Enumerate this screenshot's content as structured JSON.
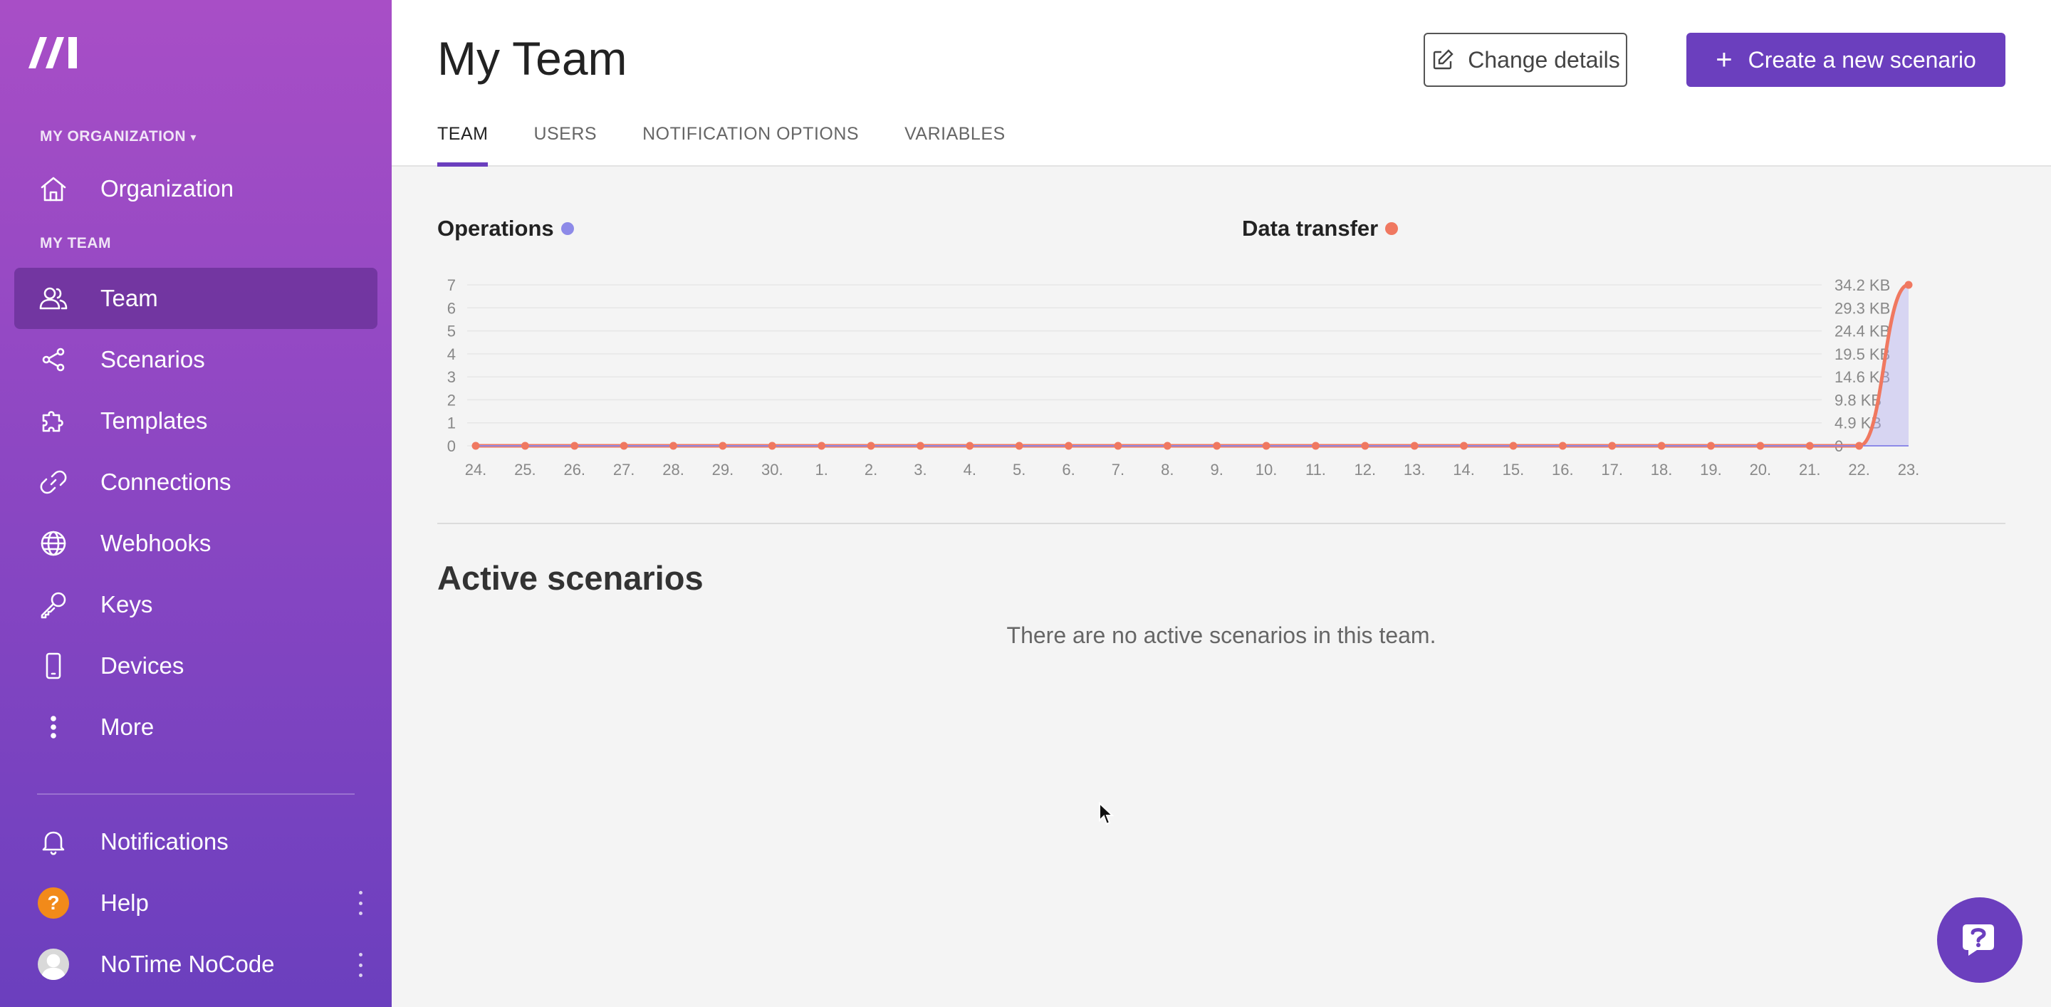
{
  "sidebar": {
    "org_label": "MY ORGANIZATION",
    "org_item": "Organization",
    "team_label": "MY TEAM",
    "items": [
      {
        "label": "Team",
        "icon": "team-icon"
      },
      {
        "label": "Scenarios",
        "icon": "share-icon"
      },
      {
        "label": "Templates",
        "icon": "puzzle-icon"
      },
      {
        "label": "Connections",
        "icon": "link-icon"
      },
      {
        "label": "Webhooks",
        "icon": "globe-icon"
      },
      {
        "label": "Keys",
        "icon": "key-icon"
      },
      {
        "label": "Devices",
        "icon": "phone-icon"
      },
      {
        "label": "More",
        "icon": "more-vertical-icon"
      }
    ],
    "notifications": "Notifications",
    "help": "Help",
    "help_badge": "?",
    "user": "NoTime NoCode"
  },
  "header": {
    "title": "My Team",
    "change_details": "Change details",
    "create_scenario": "Create a new scenario",
    "tabs": [
      "TEAM",
      "USERS",
      "NOTIFICATION OPTIONS",
      "VARIABLES"
    ],
    "active_tab": "TEAM"
  },
  "chart_data": {
    "type": "area",
    "series": [
      {
        "name": "Operations",
        "color": "#8d8ae8",
        "axis": "left",
        "values": [
          0,
          0,
          0,
          0,
          0,
          0,
          0,
          0,
          0,
          0,
          0,
          0,
          0,
          0,
          0,
          0,
          0,
          0,
          0,
          0,
          0,
          0,
          0,
          0,
          0,
          0,
          0,
          0,
          0,
          0,
          0
        ]
      },
      {
        "name": "Data transfer",
        "color": "#f07860",
        "axis": "right",
        "values": [
          0,
          0,
          0,
          0,
          0,
          0,
          0,
          0,
          0,
          0,
          0,
          0,
          0,
          0,
          0,
          0,
          0,
          0,
          0,
          0,
          0,
          0,
          0,
          0,
          0,
          0,
          0,
          0,
          0,
          34.2,
          0
        ]
      }
    ],
    "categories": [
      "24.",
      "25.",
      "26.",
      "27.",
      "28.",
      "29.",
      "30.",
      "1.",
      "2.",
      "3.",
      "4.",
      "5.",
      "6.",
      "7.",
      "8.",
      "9.",
      "10.",
      "11.",
      "12.",
      "13.",
      "14.",
      "15.",
      "16.",
      "17.",
      "18.",
      "19.",
      "20.",
      "21.",
      "22.",
      "23."
    ],
    "left_ticks": [
      "0",
      "1",
      "2",
      "3",
      "4",
      "5",
      "6",
      "7"
    ],
    "right_ticks": [
      "0",
      "4.9 KB",
      "9.8 KB",
      "14.6 KB",
      "19.5 KB",
      "24.4 KB",
      "29.3 KB",
      "34.2 KB"
    ],
    "ylim_left": [
      0,
      7
    ],
    "ylim_right": [
      0,
      34.2
    ]
  },
  "active": {
    "title": "Active scenarios",
    "empty": "There are no active scenarios in this team."
  }
}
